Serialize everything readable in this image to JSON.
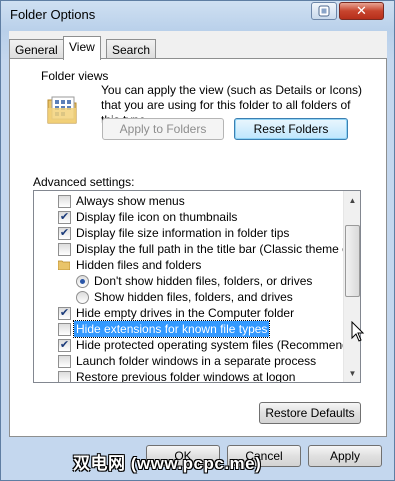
{
  "window": {
    "title": "Folder Options",
    "close_symbol": "✕"
  },
  "tabs": [
    {
      "label": "General",
      "active": false
    },
    {
      "label": "View",
      "active": true
    },
    {
      "label": "Search",
      "active": false
    }
  ],
  "folder_views": {
    "group_label": "Folder views",
    "description": "You can apply the view (such as Details or Icons) that you are using for this folder to all folders of this type.",
    "apply_button": "Apply to Folders",
    "reset_button": "Reset Folders"
  },
  "advanced": {
    "label": "Advanced settings:",
    "items": [
      {
        "type": "checkbox",
        "label": "Always show menus",
        "checked": false
      },
      {
        "type": "checkbox",
        "label": "Display file icon on thumbnails",
        "checked": true
      },
      {
        "type": "checkbox",
        "label": "Display file size information in folder tips",
        "checked": true
      },
      {
        "type": "checkbox",
        "label": "Display the full path in the title bar (Classic theme only)",
        "checked": false
      },
      {
        "type": "folder",
        "label": "Hidden files and folders"
      },
      {
        "type": "radio",
        "label": "Don't show hidden files, folders, or drives",
        "checked": true
      },
      {
        "type": "radio",
        "label": "Show hidden files, folders, and drives",
        "checked": false
      },
      {
        "type": "checkbox",
        "label": "Hide empty drives in the Computer folder",
        "checked": true
      },
      {
        "type": "checkbox",
        "label": "Hide extensions for known file types",
        "checked": false,
        "selected": true
      },
      {
        "type": "checkbox",
        "label": "Hide protected operating system files (Recommended)",
        "checked": true
      },
      {
        "type": "checkbox",
        "label": "Launch folder windows in a separate process",
        "checked": false
      },
      {
        "type": "checkbox",
        "label": "Restore previous folder windows at logon",
        "checked": false
      }
    ]
  },
  "restore_defaults_button": "Restore Defaults",
  "footer": {
    "ok_button": "OK",
    "cancel_button": "Cancel",
    "apply_button": "Apply"
  },
  "watermark": "双电网 (www.pcpc.me)",
  "colors": {
    "selection": "#3399ff",
    "title_bar": "#c4d7ee",
    "close_button": "#c7442d"
  }
}
